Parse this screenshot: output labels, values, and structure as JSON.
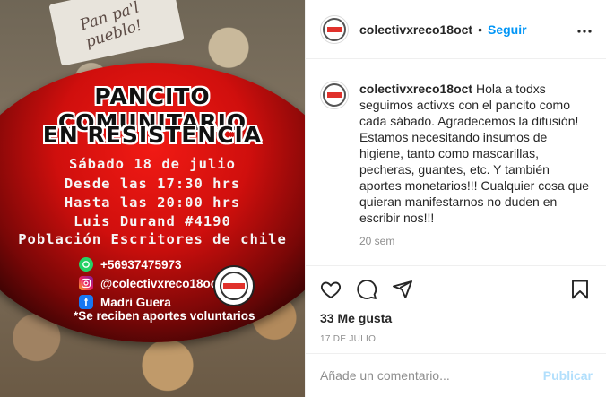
{
  "post_image": {
    "note_text": "Pan pa'l pueblo!",
    "title_line1": "PANCITO COMUNITARIO",
    "title_line2": "EN RESISTENCIA",
    "lines": [
      "Sábado 18 de julio",
      "Desde las 17:30 hrs",
      "Hasta las 20:00 hrs",
      "Luis Durand #4190",
      "Población Escritores de chile"
    ],
    "whatsapp": "+56937475973",
    "instagram": "@colectivxreco18oct",
    "facebook": "Madri Guera",
    "note": "*Se reciben aportes voluntarios",
    "colors": {
      "red": "#e0160f",
      "dark": "#1a0202"
    }
  },
  "header": {
    "username": "colectivxreco18oct",
    "separator": "•",
    "follow_label": "Seguir",
    "more_icon": "more-horizontal-icon"
  },
  "caption": {
    "username": "colectivxreco18oct",
    "text": " Hola a todxs seguimos activxs con el pancito como cada sábado. Agradecemos la difusión! Estamos necesitando insumos de higiene, tanto como mascarillas, pecheras, guantes, etc. Y también aportes monetarios!!! Cualquier cosa que quieran manifestarnos no duden en escribir nos!!!",
    "time": "20 sem"
  },
  "actions": {
    "like_icon": "heart-icon",
    "comment_icon": "comment-icon",
    "share_icon": "share-icon",
    "save_icon": "bookmark-icon"
  },
  "likes": "33 Me gusta",
  "date": "17 DE JULIO",
  "comment_box": {
    "placeholder": "Añade un comentario...",
    "publish_label": "Publicar"
  },
  "theme": {
    "accent": "#0095f6",
    "publish_disabled": "#b2dffc",
    "border": "#efefef",
    "muted": "#8e8e8e"
  }
}
